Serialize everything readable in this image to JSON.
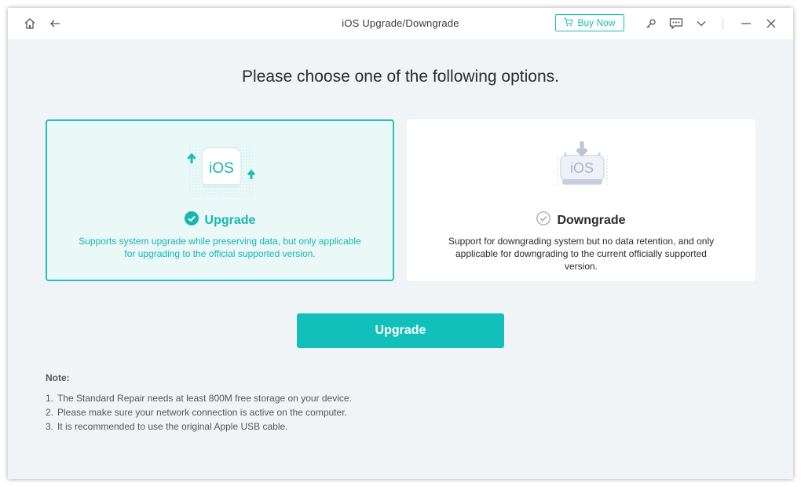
{
  "window": {
    "title": "iOS Upgrade/Downgrade"
  },
  "titlebar": {
    "buy_now_label": "Buy Now",
    "icons": [
      "home-icon",
      "back-icon",
      "cart-icon",
      "key-icon",
      "feedback-icon",
      "chevron-down-icon",
      "minimize-icon",
      "close-icon"
    ]
  },
  "main": {
    "heading": "Please choose one of the following options.",
    "options": [
      {
        "title": "Upgrade",
        "icon_text": "iOS",
        "description": "Supports system upgrade while preserving data, but only applicable for upgrading to the official supported version.",
        "selected": true
      },
      {
        "title": "Downgrade",
        "icon_text": "iOS",
        "description": "Support for downgrading system but no data retention, and only applicable for downgrading to the current officially supported version.",
        "selected": false
      }
    ],
    "action_button": "Upgrade"
  },
  "note": {
    "title": "Note:",
    "items": [
      {
        "num": "1.",
        "text": "The Standard Repair needs at least 800M free storage on your device."
      },
      {
        "num": "2.",
        "text": "Please make sure your network connection is active on the computer."
      },
      {
        "num": "3.",
        "text": "It is recommended to use the original Apple USB cable."
      }
    ]
  },
  "colors": {
    "accent": "#12c0bb",
    "selected_border": "#23c3bd",
    "selected_bg": "#eaf8f8",
    "window_bg": "#f0f4f7"
  }
}
